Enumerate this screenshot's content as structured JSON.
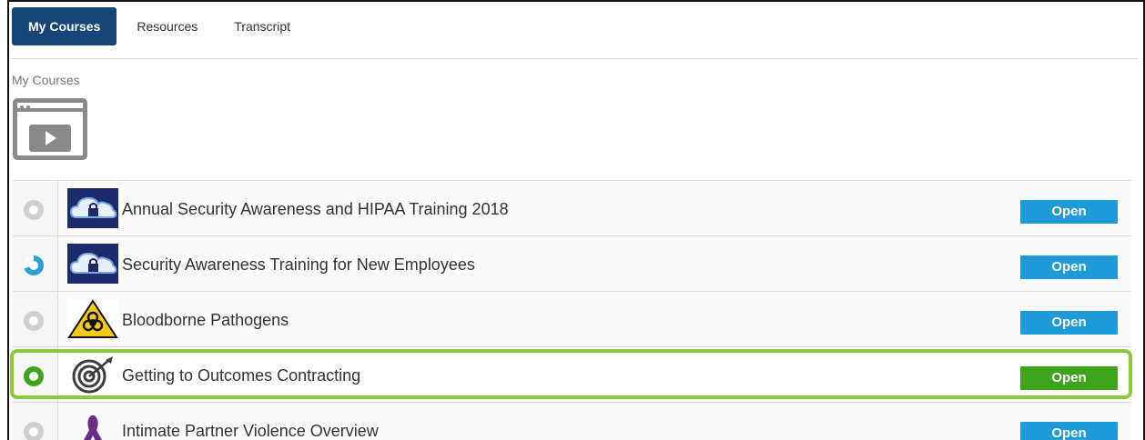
{
  "tabs": [
    {
      "label": "My Courses",
      "active": true
    },
    {
      "label": "Resources",
      "active": false
    },
    {
      "label": "Transcript",
      "active": false
    }
  ],
  "section": {
    "title": "My Courses",
    "icon": "video-course-icon"
  },
  "courses": [
    {
      "title": "Annual Security Awareness and HIPAA Training 2018",
      "status": "not-started",
      "thumb_icon": "cloud-lock-icon",
      "action_label": "Open"
    },
    {
      "title": "Security Awareness Training for New Employees",
      "status": "in-progress",
      "thumb_icon": "cloud-lock-icon",
      "action_label": "Open"
    },
    {
      "title": "Bloodborne Pathogens",
      "status": "not-started",
      "thumb_icon": "biohazard-icon",
      "action_label": "Open"
    },
    {
      "title": "Getting to Outcomes Contracting",
      "status": "complete",
      "thumb_icon": "target-icon",
      "action_label": "Open",
      "highlighted": true
    },
    {
      "title": "Intimate Partner Violence Overview",
      "status": "not-started",
      "thumb_icon": "ribbon-icon",
      "action_label": "Open"
    }
  ],
  "colors": {
    "tab_active": "#16457a",
    "open_button": "#1e9ad6",
    "open_button_highlighted": "#3ea41c",
    "highlight_border": "#8dc63f",
    "progress_blue": "#2ba0d8"
  }
}
